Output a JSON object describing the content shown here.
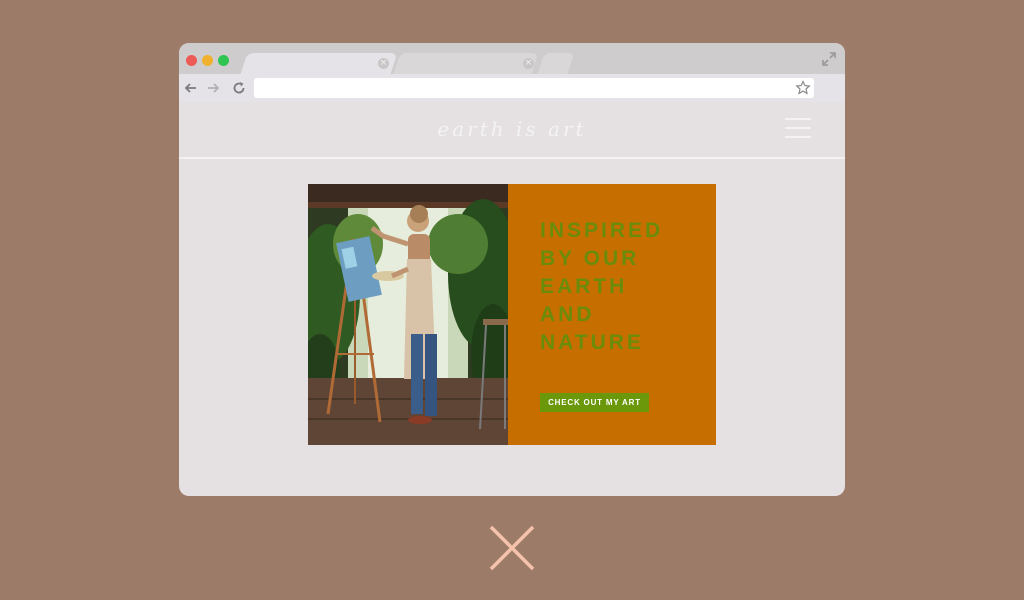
{
  "browser": {
    "traffic_lights": [
      {
        "name": "close",
        "color": "#ee5b56"
      },
      {
        "name": "minimize",
        "color": "#f0b22e"
      },
      {
        "name": "maximize",
        "color": "#2fc552"
      }
    ],
    "tabs": [
      {
        "label": "",
        "active": true
      },
      {
        "label": "",
        "active": false
      }
    ],
    "address_bar": {
      "value": "",
      "placeholder": ""
    },
    "icons": [
      "back-arrow-icon",
      "forward-arrow-icon",
      "reload-icon",
      "bookmark-star-icon",
      "expand-icon"
    ]
  },
  "site": {
    "logo": "earth is art",
    "menu_icon": "hamburger-menu-icon",
    "hero": {
      "image_alt": "artist painting at an easel among plants",
      "heading": "INSPIRED\nBY OUR\nEARTH\nAND\nNATURE",
      "cta_label": "CHECK OUT MY ART"
    }
  },
  "overlay": {
    "mark_icon": "x-mark-icon",
    "mark_color": "#f7c2ac"
  },
  "colors": {
    "page_background": "#9c7b68",
    "window_background": "#e5e0e2",
    "hero_panel": "#c66f00",
    "heading_text": "#6b8c0a",
    "cta_button": "#6a980a"
  }
}
